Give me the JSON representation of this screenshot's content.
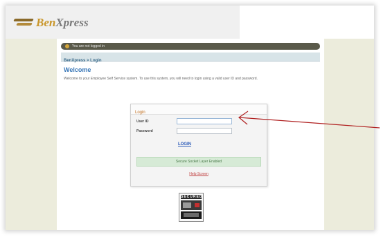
{
  "app": {
    "logo_part1": "Ben",
    "logo_part2": "Xpress"
  },
  "status_bar": {
    "text": "You are not logged in"
  },
  "breadcrumb": {
    "text": "BenXpress > Login"
  },
  "welcome": {
    "title": "Welcome",
    "text": "Welcome to your Employee Self Service system. To use this system, you will need to login using a valid user ID and password."
  },
  "login": {
    "header": "Login",
    "user_id_label": "User ID",
    "user_id_value": "",
    "password_label": "Password",
    "password_value": "",
    "submit_label": "LOGIN",
    "notice": "Secure Socket Layer Enabled",
    "help_link": "Help Screen"
  },
  "badge": {
    "top_text": "SECURED"
  },
  "colors": {
    "accent_blue": "#3a78b8",
    "logo_gold": "#c9962a",
    "arrow_red": "#b02020",
    "side_panel": "#ececdc"
  }
}
